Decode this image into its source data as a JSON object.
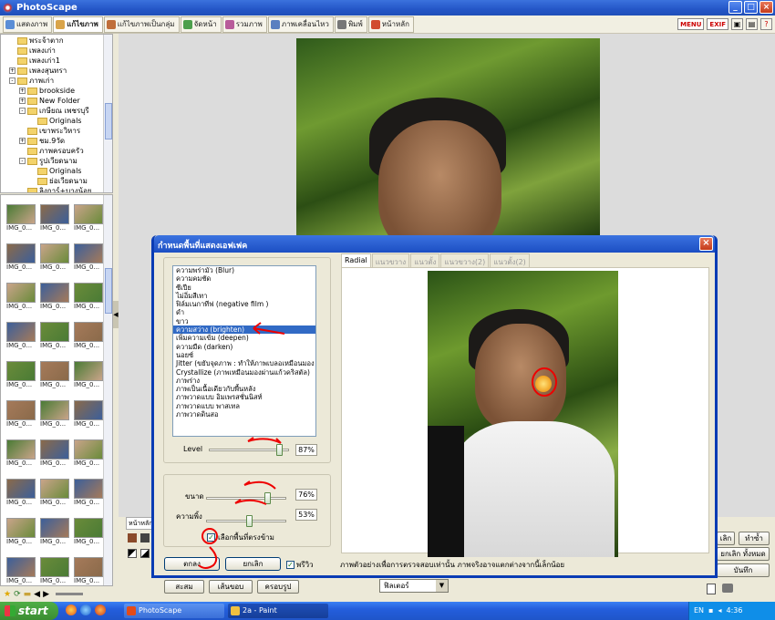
{
  "app": {
    "title": "PhotoScape"
  },
  "toolbar": {
    "tabs": [
      {
        "label": "แสดงภาพ",
        "color": "#5b8ed6"
      },
      {
        "label": "แก้ไขภาพ",
        "color": "#d9a44a"
      },
      {
        "label": "แก้ไขภาพเป็นกลุ่ม",
        "color": "#c06f3b"
      },
      {
        "label": "จัดหน้า",
        "color": "#4c9f4c"
      },
      {
        "label": "รวมภาพ",
        "color": "#b85c9a"
      },
      {
        "label": "ภาพเคลื่อนไหว",
        "color": "#5a7fc0"
      },
      {
        "label": "พิมพ์",
        "color": "#777777"
      },
      {
        "label": "หน้าหลัก",
        "color": "#d14c2f"
      }
    ],
    "menu_label": "MENU",
    "exif_label": "EXIF"
  },
  "tree": {
    "items": [
      {
        "label": "พระจ้าตาก",
        "indent": 1,
        "exp": ""
      },
      {
        "label": "เพลงเก่า",
        "indent": 1,
        "exp": ""
      },
      {
        "label": "เพลงเก่า1",
        "indent": 1,
        "exp": ""
      },
      {
        "label": "เพลงสุนทรา",
        "indent": 1,
        "exp": "+"
      },
      {
        "label": "ภาพเก่า",
        "indent": 1,
        "exp": "-"
      },
      {
        "label": "brookside",
        "indent": 2,
        "exp": "+"
      },
      {
        "label": "New Folder",
        "indent": 2,
        "exp": "+"
      },
      {
        "label": "เกษียณ เพชรบุรี",
        "indent": 2,
        "exp": "-"
      },
      {
        "label": "Originals",
        "indent": 3,
        "exp": ""
      },
      {
        "label": "เขาพระวิหาร",
        "indent": 2,
        "exp": ""
      },
      {
        "label": "ชม.9วัด",
        "indent": 2,
        "exp": "+"
      },
      {
        "label": "ภาพครอบครัว",
        "indent": 2,
        "exp": ""
      },
      {
        "label": "รูปเวียดนาม",
        "indent": 2,
        "exp": "-"
      },
      {
        "label": "Originals",
        "indent": 3,
        "exp": ""
      },
      {
        "label": "ย่อเวียดนาม",
        "indent": 3,
        "exp": ""
      },
      {
        "label": "ลิงการ์+บางน้อย",
        "indent": 2,
        "exp": ""
      }
    ]
  },
  "thumbnails": {
    "caption": "IMG_0..."
  },
  "dialog": {
    "title": "กำหนดพื้นที่แสดงเอฟเฟค",
    "effects": [
      "ความพร่ามัว (Blur)",
      "ความคมชัด",
      "ซีเปีย",
      "ไม่อิ่มสีเทา",
      "ฟิล์มเนกาทีฟ (negative film )",
      "ดำ",
      "ขาว",
      "ความสว่าง (brighten)",
      "เพิ่มความเข้ม (deepen)",
      "ความมืด (darken)",
      "นอยซ์",
      "Jitter (ขยับจุดภาพ : ทำให้ภาพเบลอเหมือนมอง",
      "Crystallize (ภาพเหมือนมองผ่านแก้วคริสตัล)",
      "ภาพร่าง",
      "ภาพเป็นเนื้อเดียวกับพื้นหลัง",
      "ภาพวาดแบบ อิมเพรสชั่นนิสท์",
      "ภาพวาดแบบ พาสเทล",
      "ภาพวาดดินสอ"
    ],
    "selected_index": 7,
    "level": {
      "label": "Level",
      "value": "87%",
      "fraction": 0.87
    },
    "size": {
      "label": "ขนาด",
      "value": "76%",
      "fraction": 0.76
    },
    "sharpness": {
      "label": "ความพิ้ง",
      "value": "53%",
      "fraction": 0.53
    },
    "invert_label": "เลือกพื้นที่ตรงข้าม",
    "ok_label": "ตกลง",
    "cancel_label": "ยกเลิก",
    "preview_label": "พรีวิว",
    "preview_tabs": [
      "Radial",
      "แนวขวาง",
      "แนวตั้ง",
      "แนวขวาง(2)",
      "แนวตั้ง(2)"
    ],
    "note": "ภาพตัวอย่างเพื่อการตรวจสอบเท่านั้น ภาพจริงอาจแตกต่างจากนี้เล็กน้อย"
  },
  "bottom": {
    "tab_label": "หน้าหลัก",
    "buttons_left": [
      "สะสม",
      "เส้นขอบ",
      "ครอบรูป"
    ],
    "filter_label": "ฟิลเตอร์",
    "right_buttons": [
      "เลิก",
      "ทำซ้ำ",
      "ยกเลิก ทั้งหมด",
      "บันทึก"
    ]
  },
  "taskbar": {
    "start_label": "start",
    "tasks": [
      "PhotoScape",
      "2a - Paint"
    ],
    "lang": "EN",
    "clock": "4:36"
  }
}
